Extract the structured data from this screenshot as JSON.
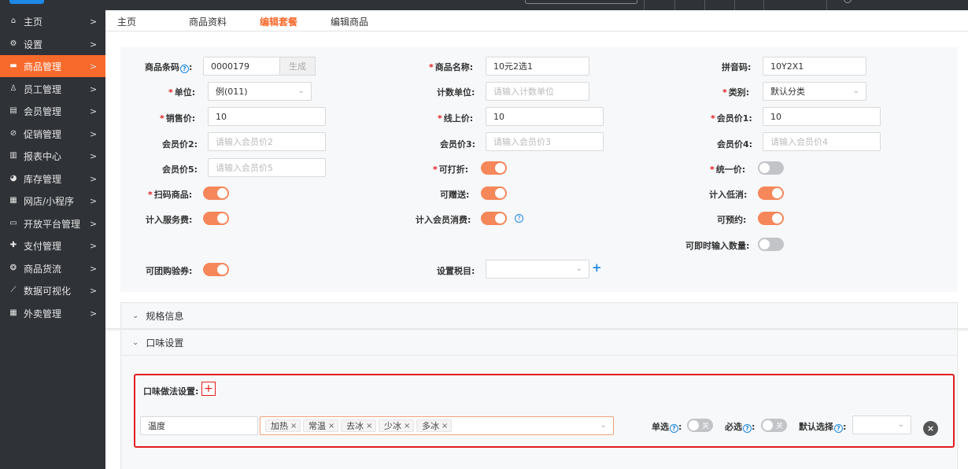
{
  "sidebar": {
    "items": [
      {
        "label": "主页",
        "icon": "home-icon",
        "glyph": "⌂"
      },
      {
        "label": "设置",
        "icon": "gear-icon",
        "glyph": "⚙"
      },
      {
        "label": "商品管理",
        "icon": "goods-icon",
        "glyph": "▬",
        "active": true
      },
      {
        "label": "员工管理",
        "icon": "staff-icon",
        "glyph": "♙"
      },
      {
        "label": "会员管理",
        "icon": "member-icon",
        "glyph": "▤"
      },
      {
        "label": "促销管理",
        "icon": "promotion-icon",
        "glyph": "⊘"
      },
      {
        "label": "报表中心",
        "icon": "report-icon",
        "glyph": "▥"
      },
      {
        "label": "库存管理",
        "icon": "inventory-icon",
        "glyph": "◕"
      },
      {
        "label": "网店/小程序",
        "icon": "shop-icon",
        "glyph": "▦"
      },
      {
        "label": "开放平台管理",
        "icon": "platform-icon",
        "glyph": "▭"
      },
      {
        "label": "支付管理",
        "icon": "payment-icon",
        "glyph": "✚"
      },
      {
        "label": "商品货流",
        "icon": "logistics-icon",
        "glyph": "❂"
      },
      {
        "label": "数据可视化",
        "icon": "chart-icon",
        "glyph": "⟋"
      },
      {
        "label": "外卖管理",
        "icon": "takeout-icon",
        "glyph": "▦"
      }
    ],
    "chevron": ">"
  },
  "tabs": [
    {
      "label": "主页"
    },
    {
      "label": "商品资料"
    },
    {
      "label": "编辑套餐",
      "active": true
    },
    {
      "label": "编辑商品"
    }
  ],
  "form": {
    "barcode": {
      "label": "商品条码",
      "value": "0000179",
      "button": "生成",
      "help": "?"
    },
    "name": {
      "label": "商品名称:",
      "value": "10元2选1"
    },
    "pinyin": {
      "label": "拼音码:",
      "value": "10Y2X1"
    },
    "unit": {
      "label": "单位:",
      "value": "例(011)"
    },
    "count_unit": {
      "label": "计数单位:",
      "placeholder": "请输入计数单位"
    },
    "category": {
      "label": "类别:",
      "value": "默认分类"
    },
    "sale_price": {
      "label": "销售价:",
      "value": "10"
    },
    "online_price": {
      "label": "线上价:",
      "value": "10"
    },
    "member_price1": {
      "label": "会员价1:",
      "value": "10"
    },
    "member_price2": {
      "label": "会员价2:",
      "placeholder": "请输入会员价2"
    },
    "member_price3": {
      "label": "会员价3:",
      "placeholder": "请输入会员价3"
    },
    "member_price4": {
      "label": "会员价4:",
      "placeholder": "请输入会员价4"
    },
    "member_price5": {
      "label": "会员价5:",
      "placeholder": "请输入会员价5"
    },
    "discountable": {
      "label": "可打折:",
      "on": true
    },
    "uniform_price": {
      "label": "统一价:",
      "on": false
    },
    "scan_goods": {
      "label": "扫码商品:",
      "on": true
    },
    "giftable": {
      "label": "可赠送:",
      "on": true
    },
    "count_min": {
      "label": "计入低消:",
      "on": true
    },
    "service_fee": {
      "label": "计入服务费:",
      "on": true
    },
    "member_consume": {
      "label": "计入会员消费:",
      "on": true
    },
    "reservable": {
      "label": "可预约:",
      "on": true
    },
    "instant_qty": {
      "label": "可即时输入数量:",
      "on": false
    },
    "group_voucher": {
      "label": "可团购验券:",
      "on": true
    },
    "tax": {
      "label": "设置税目:",
      "value": ""
    },
    "plus": "+",
    "dropdown_glyph": "⌄",
    "help_glyph": "?"
  },
  "panels": {
    "spec": {
      "label": "规格信息"
    },
    "flavor": {
      "label": "口味设置"
    },
    "arrow": "⌄"
  },
  "flavor": {
    "title": "口味做法设置:",
    "add": "+",
    "name_value": "温度",
    "tags": [
      "加热",
      "常温",
      "去冰",
      "少冰",
      "多冰"
    ],
    "tag_close": "×",
    "single": {
      "label": "单选",
      "state": "关"
    },
    "required": {
      "label": "必选",
      "state": "关"
    },
    "default_label": "默认选择",
    "default_value": "",
    "help": "?",
    "delete": "×"
  }
}
